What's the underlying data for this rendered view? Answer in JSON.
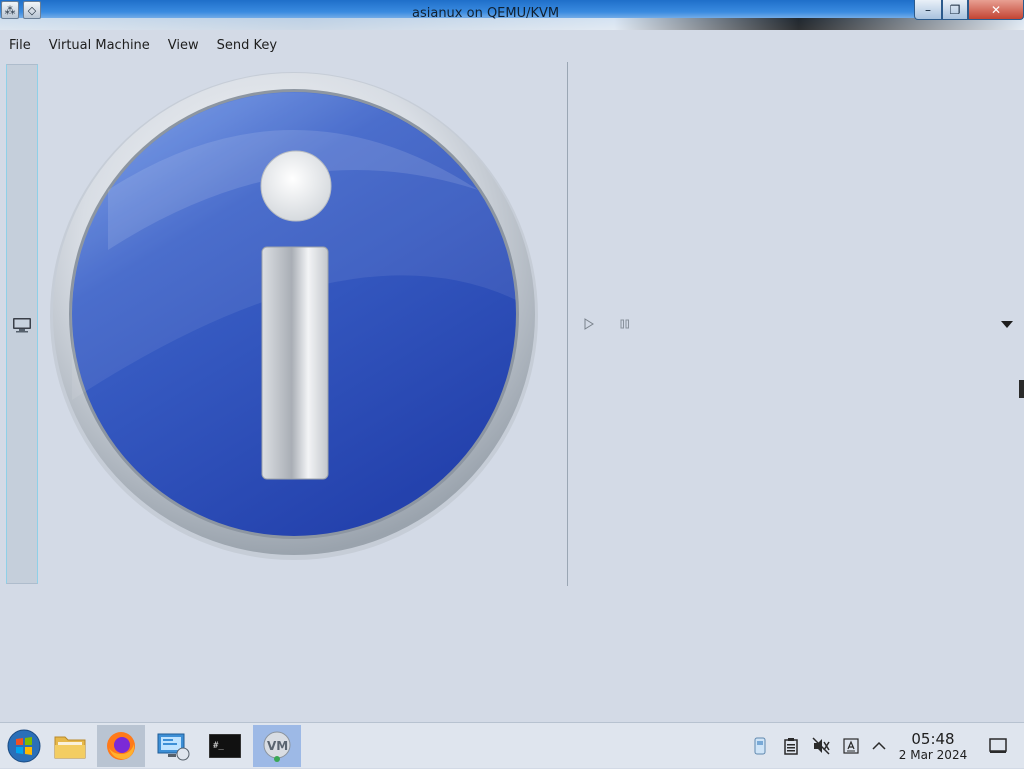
{
  "window": {
    "title": "asianux on QEMU/KVM"
  },
  "titlebar_buttons": {
    "minimize": "–",
    "maximize": "❐",
    "close": "✕"
  },
  "menu": {
    "items": [
      "File",
      "Virtual Machine",
      "View",
      "Send Key"
    ]
  },
  "colors": {
    "info_circle_blue": "#2e4fb5",
    "info_circle_light": "#6f97e8",
    "panel_bg": "#d3dae6",
    "taskbar_bg": "#dfe5ee"
  },
  "icons": {
    "info": "information-icon",
    "console": "monitor-icon",
    "play": "play-icon",
    "pause": "pause-icon",
    "dropdown": "chevron-down-icon"
  },
  "taskbar": {
    "apps": [
      {
        "name": "start-menu",
        "icon": "windows-start-icon"
      },
      {
        "name": "file-manager",
        "icon": "folder-icon"
      },
      {
        "name": "firefox",
        "icon": "firefox-icon"
      },
      {
        "name": "remote-desktop",
        "icon": "remote-desktop-icon"
      },
      {
        "name": "terminal",
        "icon": "terminal-icon",
        "label": "#_"
      },
      {
        "name": "virt-manager",
        "icon": "virt-manager-icon",
        "label": "VM"
      }
    ],
    "clock": {
      "time": "05:48",
      "date": "2 Mar 2024"
    }
  }
}
